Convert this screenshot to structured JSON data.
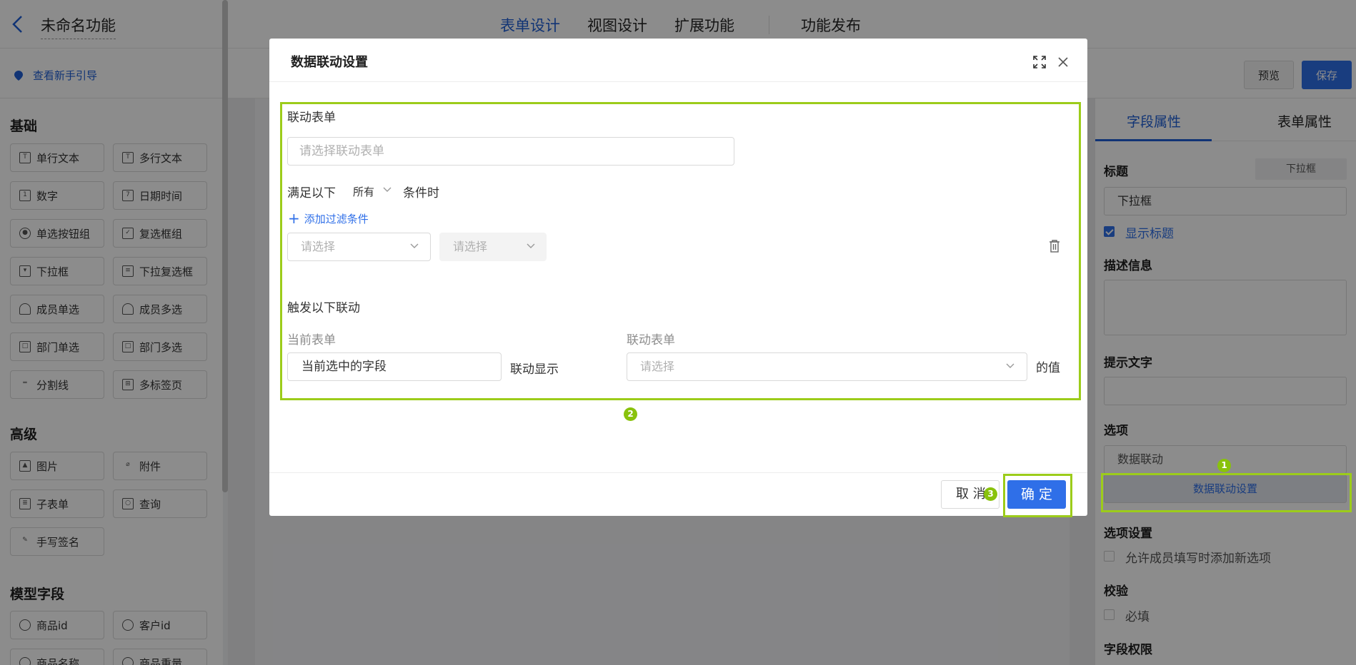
{
  "app": {
    "title": "未命名功能"
  },
  "top_tabs": [
    {
      "label": "表单设计",
      "active": true
    },
    {
      "label": "视图设计",
      "active": false
    },
    {
      "label": "扩展功能",
      "active": false
    },
    {
      "label": "功能发布",
      "active": false
    }
  ],
  "subbar": {
    "guide_label": "查看新手引导",
    "preview_label": "预览",
    "save_label": "保存"
  },
  "left_panel": {
    "basic_title": "基础",
    "basic_fields": [
      "单行文本",
      "多行文本",
      "数字",
      "日期时间",
      "单选按钮组",
      "复选框组",
      "下拉框",
      "下拉复选框",
      "成员单选",
      "成员多选",
      "部门单选",
      "部门多选",
      "分割线",
      "多标签页"
    ],
    "advanced_title": "高级",
    "advanced_fields": [
      "图片",
      "附件",
      "子表单",
      "查询",
      "手写签名"
    ],
    "model_title": "模型字段",
    "model_fields": [
      "商品id",
      "客户id",
      "商品名称",
      "商品重量"
    ]
  },
  "right_panel": {
    "tabs": [
      "字段属性",
      "表单属性"
    ],
    "title_label": "标题",
    "title_tag": "下拉框",
    "title_value": "下拉框",
    "show_title_label": "显示标题",
    "desc_label": "描述信息",
    "hint_label": "提示文字",
    "options_label": "选项",
    "options_value": "数据联动",
    "linkage_button": "数据联动设置",
    "option_settings_label": "选项设置",
    "allow_add_label": "允许成员填写时添加新选项",
    "validation_label": "校验",
    "required_label": "必填",
    "permission_label": "字段权限"
  },
  "modal": {
    "title": "数据联动设置",
    "linked_form_label": "联动表单",
    "linked_form_placeholder": "请选择联动表单",
    "condition_prefix": "满足以下",
    "condition_mode": "所有",
    "condition_suffix": "条件时",
    "add_filter_label": "添加过滤条件",
    "filter_select_1": "请选择",
    "filter_select_2": "请选择",
    "trigger_label": "触发以下联动",
    "current_form_label": "当前表单",
    "linked_form_col_label": "联动表单",
    "current_field_value": "当前选中的字段",
    "linkage_display_label": "联动显示",
    "linked_field_placeholder": "请选择",
    "value_suffix": "的值",
    "cancel_label": "取 消",
    "ok_label": "确 定"
  },
  "badges": {
    "b1": "1",
    "b2": "2",
    "b3": "3"
  },
  "colors": {
    "accent": "#2f6fe8",
    "highlight": "#9ccc1a"
  }
}
